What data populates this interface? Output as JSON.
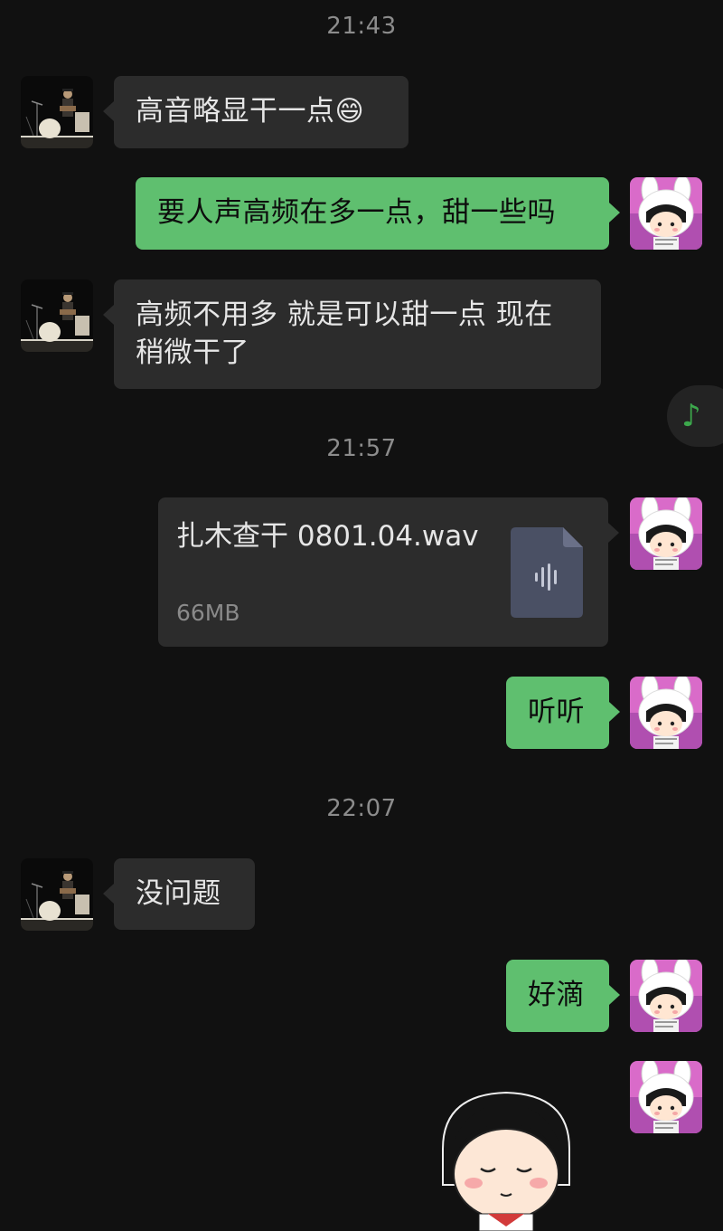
{
  "messages": {
    "ts1": "21:43",
    "m1": "高音略显干一点😄",
    "m2": "要人声高频在多一点，甜一些吗",
    "m3": "高频不用多 就是可以甜一点 现在稍微干了",
    "ts2": "21:57",
    "file": {
      "name": "扎木查干 0801.04.wav",
      "size": "66MB"
    },
    "m5": "听听",
    "ts3": "22:07",
    "m6": "没问题",
    "m7": "好滴"
  },
  "floating_player": {
    "icon": "music-note-icon",
    "glyph": "♪"
  },
  "colors": {
    "background": "#111111",
    "incoming_bubble": "#2c2c2c",
    "outgoing_bubble": "#5fbf6f",
    "player_accent": "#3ca84c"
  }
}
